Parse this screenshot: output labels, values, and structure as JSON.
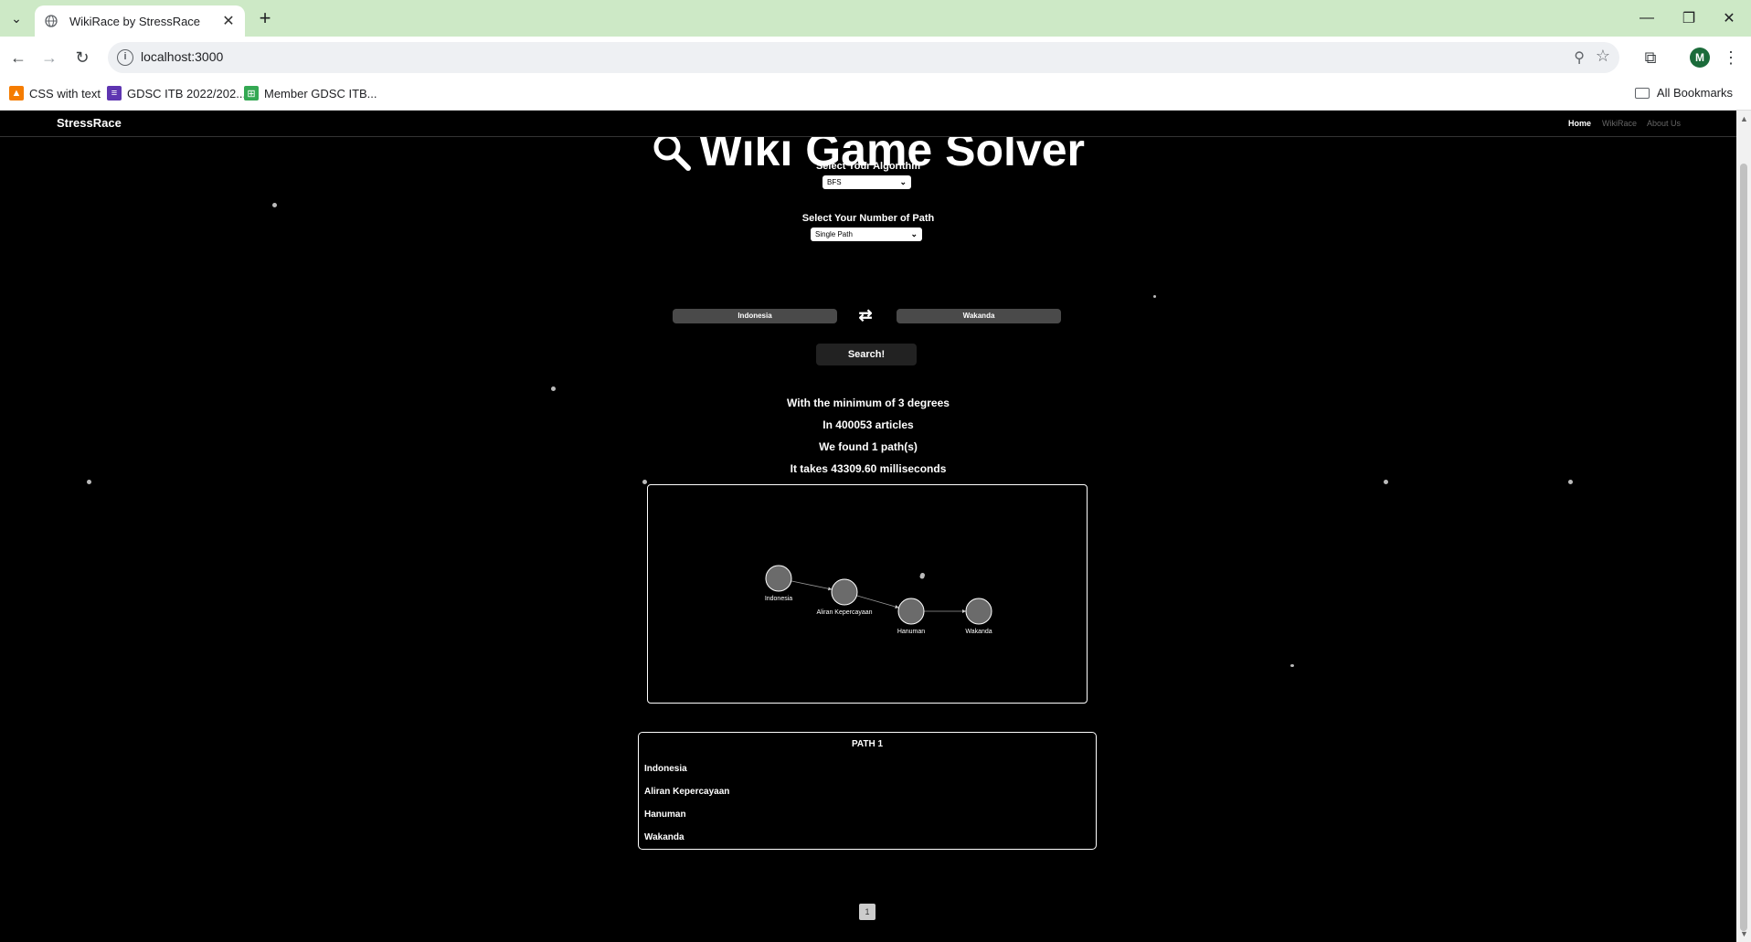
{
  "browser": {
    "tab_title": "WikiRace by StressRace",
    "url": "localhost:3000",
    "bookmarks": [
      {
        "label": "CSS with text",
        "color": "#f57c00"
      },
      {
        "label": "GDSC ITB 2022/202...",
        "color": "#5e35b1"
      },
      {
        "label": "Member GDSC ITB...",
        "color": "#34a853"
      }
    ],
    "all_bookmarks": "All Bookmarks",
    "profile_initial": "M"
  },
  "site": {
    "brand": "StressRace",
    "nav": [
      {
        "label": "Home",
        "active": true
      },
      {
        "label": "WikiRace",
        "active": false
      },
      {
        "label": "About Us",
        "active": false
      }
    ],
    "heading": "Wiki Game Solver"
  },
  "form": {
    "algorithm_label": "Select Your Algorithm",
    "algorithm_value": "BFS",
    "path_label": "Select Your Number of Path",
    "path_value": "Single Path",
    "source": "Indonesia",
    "target": "Wakanda",
    "search_label": "Search!"
  },
  "results": {
    "degrees_line": "With the minimum of 3 degrees",
    "articles_line": "In 400053 articles",
    "paths_line": "We found 1 path(s)",
    "time_line": "It takes 43309.60 milliseconds"
  },
  "graph": {
    "nodes": [
      "Indonesia",
      "Aliran Kepercayaan",
      "Hanuman",
      "Wakanda"
    ]
  },
  "path_list": {
    "title": "PATH 1",
    "items": [
      "Indonesia",
      "Aliran Kepercayaan",
      "Hanuman",
      "Wakanda"
    ]
  },
  "pagination": {
    "current": "1"
  },
  "colors": {
    "background": "#000000",
    "node_fill": "#6b6b6b",
    "chrome_frame": "#cde9c6"
  }
}
